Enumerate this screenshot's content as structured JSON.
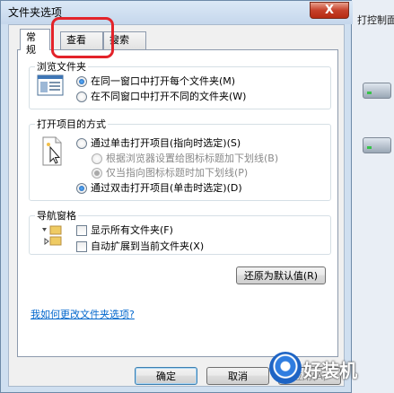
{
  "window": {
    "title": "文件夹选项",
    "close_label": "X"
  },
  "background": {
    "explorer_text": "打控制面"
  },
  "tabs": [
    {
      "label": "常规",
      "active": true
    },
    {
      "label": "查看",
      "active": false
    },
    {
      "label": "搜索",
      "active": false
    }
  ],
  "browse_folders": {
    "legend": "浏览文件夹",
    "options": [
      {
        "label": "在同一窗口中打开每个文件夹(M)",
        "selected": true
      },
      {
        "label": "在不同窗口中打开不同的文件夹(W)",
        "selected": false
      }
    ]
  },
  "open_items": {
    "legend": "打开项目的方式",
    "single_click": {
      "label": "通过单击打开项目(指向时选定)(S)",
      "selected": false
    },
    "underline_options": [
      {
        "label": "根据浏览器设置给图标标题加下划线(B)",
        "selected": false,
        "enabled": false
      },
      {
        "label": "仅当指向图标标题时加下划线(P)",
        "selected": true,
        "enabled": false
      }
    ],
    "double_click": {
      "label": "通过双击打开项目(单击时选定)(D)",
      "selected": true
    }
  },
  "navigation_pane": {
    "legend": "导航窗格",
    "options": [
      {
        "label": "显示所有文件夹(F)",
        "checked": false
      },
      {
        "label": "自动扩展到当前文件夹(X)",
        "checked": false
      }
    ]
  },
  "restore_defaults_label": "还原为默认值(R)",
  "help_link": "我如何更改文件夹选项?",
  "footer": {
    "ok_label": "确定",
    "cancel_label": "取消",
    "apply_label": "应用(A)"
  },
  "watermark": {
    "text": "好装机"
  },
  "colors": {
    "accent_link": "#0066cc",
    "highlight_outline": "#e3232a"
  }
}
